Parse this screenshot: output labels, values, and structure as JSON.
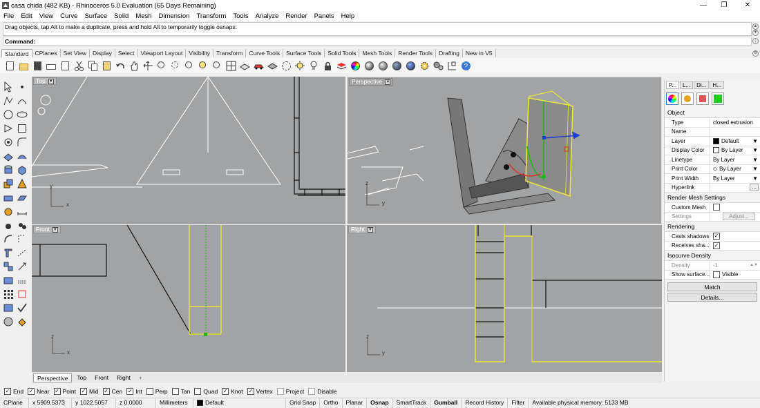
{
  "window": {
    "title": "casa chida (482 KB) - Rhinoceros 5.0 Evaluation (65 Days Remaining)"
  },
  "menu": [
    "File",
    "Edit",
    "View",
    "Curve",
    "Surface",
    "Solid",
    "Mesh",
    "Dimension",
    "Transform",
    "Tools",
    "Analyze",
    "Render",
    "Panels",
    "Help"
  ],
  "command": {
    "history": "Drag objects, tap Alt to make a duplicate, press and hold Alt to temporarily toggle osnaps:",
    "prompt": "Command:"
  },
  "toolbar_tabs": [
    "Standard",
    "CPlanes",
    "Set View",
    "Display",
    "Select",
    "Viewport Layout",
    "Visibility",
    "Transform",
    "Curve Tools",
    "Surface Tools",
    "Solid Tools",
    "Mesh Tools",
    "Render Tools",
    "Drafting",
    "New in V5"
  ],
  "viewports": {
    "top": "Top",
    "perspective": "Perspective",
    "front": "Front",
    "right": "Right"
  },
  "viewport_tabs": [
    "Perspective",
    "Top",
    "Front",
    "Right"
  ],
  "viewport_tabs_add": "+",
  "axes": {
    "x": "x",
    "y": "y",
    "z": "z"
  },
  "properties": {
    "tabs": [
      "P...",
      "L...",
      "Di...",
      "H..."
    ],
    "object_header": "Object",
    "rows": [
      {
        "k": "Type",
        "v": "closed extrusion"
      },
      {
        "k": "Name",
        "v": ""
      },
      {
        "k": "Layer",
        "v": "Default"
      },
      {
        "k": "Display Color",
        "v": "By Layer"
      },
      {
        "k": "Linetype",
        "v": "By Layer"
      },
      {
        "k": "Print Color",
        "v": "By Layer"
      },
      {
        "k": "Print Width",
        "v": "By Layer"
      },
      {
        "k": "Hyperlink",
        "v": ""
      }
    ],
    "hyperlink_button": "...",
    "render_mesh_header": "Render Mesh Settings",
    "custom_mesh": "Custom Mesh",
    "settings": "Settings",
    "adjust": "Adjust...",
    "rendering_header": "Rendering",
    "casts_shadows": "Casts shadows",
    "receives_shadows": "Receives sha...",
    "isocurve_header": "Isocurve Density",
    "density": "Density",
    "density_value": "-1",
    "show_surface": "Show surface...",
    "visible": "Visible",
    "match": "Match",
    "details": "Details..."
  },
  "osnaps": [
    {
      "label": "End",
      "checked": true
    },
    {
      "label": "Near",
      "checked": true
    },
    {
      "label": "Point",
      "checked": true
    },
    {
      "label": "Mid",
      "checked": true
    },
    {
      "label": "Cen",
      "checked": true
    },
    {
      "label": "Int",
      "checked": true
    },
    {
      "label": "Perp",
      "checked": false
    },
    {
      "label": "Tan",
      "checked": false
    },
    {
      "label": "Quad",
      "checked": false
    },
    {
      "label": "Knot",
      "checked": true
    },
    {
      "label": "Vertex",
      "checked": true
    },
    {
      "label": "Project",
      "checked": false
    },
    {
      "label": "Disable",
      "checked": false
    }
  ],
  "status": {
    "cplane": "CPlane",
    "x": "x 5909.5373",
    "y": "y 1022.5057",
    "z": "z 0.0000",
    "units": "Millimeters",
    "layer": "Default",
    "grid_snap": "Grid Snap",
    "ortho": "Ortho",
    "planar": "Planar",
    "osnap": "Osnap",
    "smarttrack": "SmartTrack",
    "gumball": "Gumball",
    "record_history": "Record History",
    "filter": "Filter",
    "memory": "Available physical memory: 5133 MB"
  },
  "colors": {
    "viewport_bg": "#a2a3a4",
    "selection": "#e8e83a",
    "accent": "#3c78d8"
  }
}
